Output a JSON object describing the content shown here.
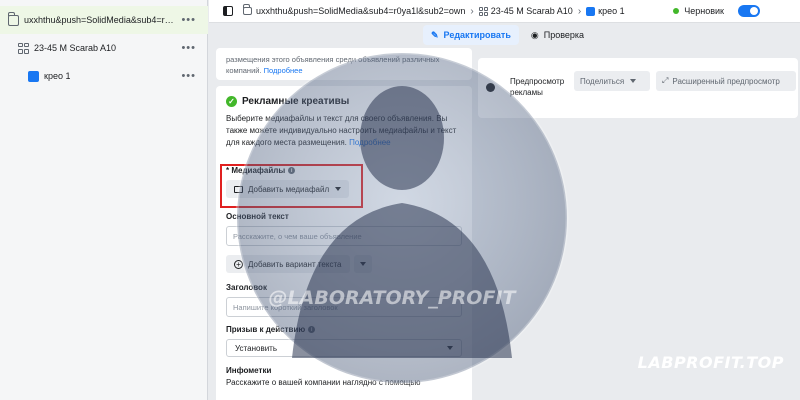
{
  "tree": {
    "campaign": "uxxhthu&push=SolidMedia&sub4=r0ya...",
    "adset": "23-45 M Scarab A10",
    "ad": "крео 1",
    "more": "•••"
  },
  "topbar": {
    "crumb_campaign": "uxxhthu&push=SolidMedia&sub4=r0ya1l&sub2=own",
    "crumb_adset": "23-45 M Scarab A10",
    "crumb_ad": "крео 1",
    "status": "Черновик"
  },
  "tabs": {
    "edit": "Редактировать",
    "preview": "Проверка"
  },
  "placement_card": {
    "text": "размещения этого объявления среди объявлений различных компаний.",
    "link": "Подробнее"
  },
  "creative": {
    "title": "Рекламные креативы",
    "description": "Выберите медиафайлы и текст для своего объявления. Вы также можете индивидуально настроить медиафайлы и текст для каждого места размещения.",
    "link": "Подробнее",
    "media_label": "* Медиафайлы",
    "add_media": "Добавить медиафайл",
    "primary_text_label": "Основной текст",
    "primary_text_placeholder": "Расскажите, о чем ваше объявление",
    "add_variant": "Добавить вариант текста",
    "headline_label": "Заголовок",
    "headline_placeholder": "Напишите короткий заголовок",
    "cta_label": "Призыв к действию",
    "cta_value": "Установить",
    "infometrics_label": "Инфометки",
    "infometrics_text": "Расскажите о вашей компании наглядно с помощью"
  },
  "preview": {
    "label": "Предпросмотр рекламы",
    "share": "Поделиться",
    "advanced": "Расширенный предпросмотр"
  },
  "watermark": {
    "text": "@LABORATORY_PROFIT"
  },
  "brand": "LABPROFIT.TOP"
}
